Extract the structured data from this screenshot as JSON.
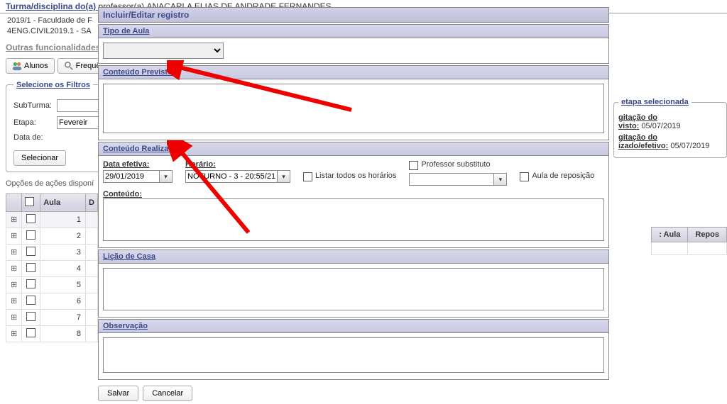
{
  "header": {
    "label": "Turma/disciplina do(a)",
    "prof_label": "professor(a)",
    "prof_name": "ANACARLA ELIAS DE ANDRADE FERNANDES"
  },
  "context": {
    "line1": "2019/1 - Faculdade de F",
    "line2": "4ENG.CIVIL2019.1 - SA"
  },
  "section_outras": "Outras funcionalidades",
  "toolbar": {
    "alunos": "Alunos",
    "freq": "Frequê"
  },
  "filters": {
    "legend": "Selecione os Filtros",
    "subturma_label": "SubTurma:",
    "etapa_label": "Etapa:",
    "etapa_value": "Fevereir",
    "datade_label": "Data de:",
    "selecionar": "Selecionar"
  },
  "opts": "Opções de ações disponí",
  "table": {
    "col_checkbox": "",
    "col_aula": "Aula",
    "col_d": "D",
    "rows": [
      1,
      2,
      3,
      4,
      5,
      6,
      7,
      8
    ]
  },
  "modal": {
    "title": "Incluir/Editar registro",
    "tipo_label": "Tipo de Aula",
    "previsto_label": "Conteúdo Previsto",
    "realizado_label": "Conteúdo Realizado",
    "data_efetiva_label": "Data efetiva:",
    "data_efetiva_value": "29/01/2019",
    "horario_label": "Horário:",
    "horario_value": "NOTURNO - 3 - 20:55/21:",
    "listar_label": "Listar todos os horários",
    "prof_sub_label": "Professor substituto",
    "aula_rep_label": "Aula de reposição",
    "conteudo_label": "Conteúdo:",
    "licao_label": "Lição de Casa",
    "obs_label": "Observação",
    "salvar": "Salvar",
    "cancelar": "Cancelar"
  },
  "right": {
    "legend": "etapa selecionada",
    "line1_label": "gitação do",
    "line1_end": "visto:",
    "line1_date": "05/07/2019",
    "line2_label": "gitação do",
    "line2_end": "izado/efetivo:",
    "line2_date": "05/07/2019"
  },
  "right_table": {
    "col1": ": Aula",
    "col2": "Repos"
  }
}
